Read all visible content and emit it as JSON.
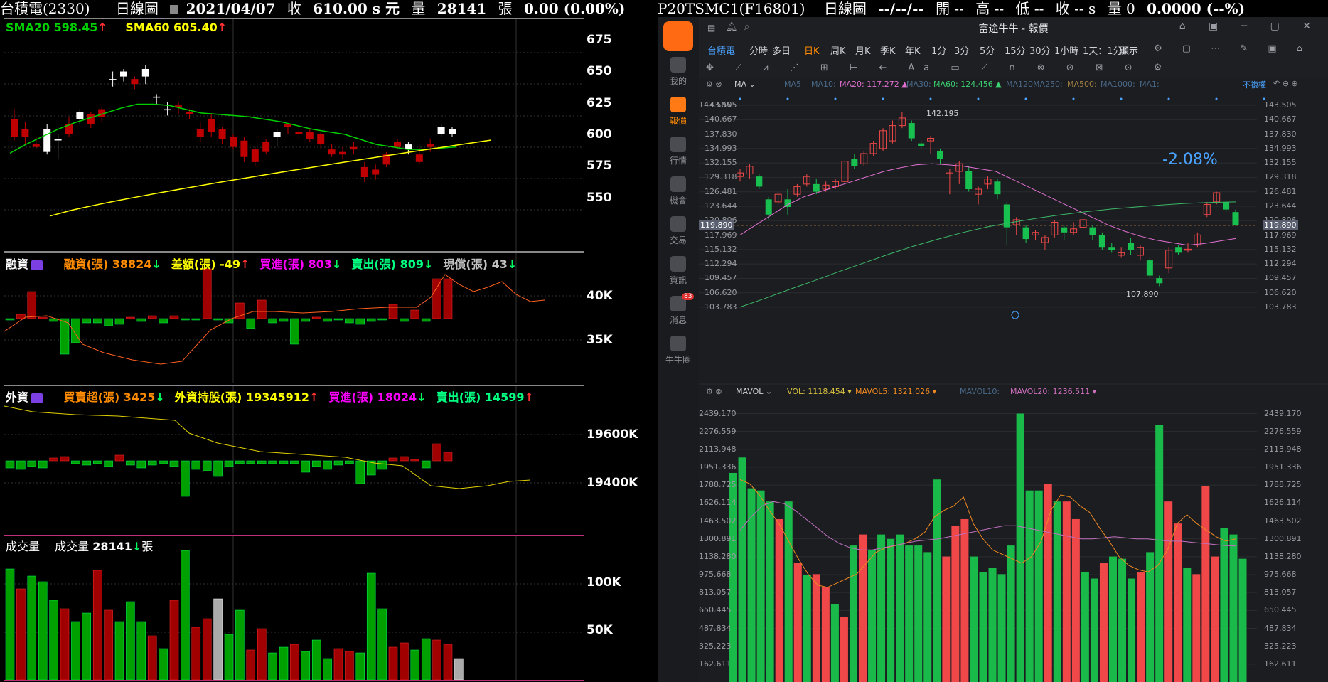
{
  "left_header": {
    "stock": "台積電(2330)",
    "chart_type": "日線圖",
    "date": "2021/04/07",
    "close_label": "收",
    "close_value": "610.00 s 元",
    "volume_label": "量",
    "volume_value": "28141",
    "volume_unit": "張",
    "change": "0.00 (0.00%)"
  },
  "price_panel": {
    "sma20_label": "SMA20 598.45",
    "sma60_label": "SMA60 605.40",
    "yticks": [
      "675",
      "650",
      "625",
      "600",
      "575",
      "550"
    ],
    "colors": {
      "sma20": "#00d000",
      "sma60": "#ffff00",
      "up": "#ffffff",
      "down": "#c00000"
    }
  },
  "margin_panel": {
    "title": "融資",
    "items": [
      {
        "label": "融資(張)",
        "value": "38824",
        "dir": "down",
        "color": "#ff8c00"
      },
      {
        "label": "差額(張)",
        "value": "-49",
        "dir": "up",
        "color": "#ffff00"
      },
      {
        "label": "買進(張)",
        "value": "803",
        "dir": "down",
        "color": "#ff00ff"
      },
      {
        "label": "賣出(張)",
        "value": "809",
        "dir": "down",
        "color": "#00ff80"
      },
      {
        "label": "現償(張)",
        "value": "43",
        "dir": "down",
        "color": "#c0c0c0"
      }
    ],
    "yticks": [
      "40K",
      "35K"
    ]
  },
  "foreign_panel": {
    "title": "外資",
    "items": [
      {
        "label": "買賣超(張)",
        "value": "3425",
        "dir": "down",
        "color": "#ff8c00"
      },
      {
        "label": "外資持股(張)",
        "value": "19345912",
        "dir": "up",
        "color": "#ffff00"
      },
      {
        "label": "買進(張)",
        "value": "18024",
        "dir": "down",
        "color": "#ff00ff"
      },
      {
        "label": "賣出(張)",
        "value": "14599",
        "dir": "up",
        "color": "#00ff80"
      }
    ],
    "yticks": [
      "19600K",
      "19400K"
    ]
  },
  "volume_panel": {
    "title": "成交量",
    "label": "成交量",
    "value": "28141",
    "unit": "張",
    "yticks": [
      "100K",
      "50K"
    ]
  },
  "right_header": {
    "code": "P20TSMC1(F16801)",
    "chart_type": "日線圖",
    "date": "--/--/--",
    "open": "開 --",
    "high": "高 --",
    "low": "低 --",
    "close": "收 -- s",
    "volume": "量 0",
    "change": "0.0000 (--%)"
  },
  "app": {
    "title": "富途牛牛 - 報價",
    "stock_tab": "台積電",
    "tabs": [
      "分時",
      "多日",
      "日K",
      "周K",
      "月K",
      "季K",
      "年K",
      "1分",
      "3分",
      "5分",
      "15分",
      "30分",
      "1小時",
      "1天：1分K"
    ],
    "active_tab": "日K",
    "display_label": "顯示",
    "sidebar": [
      {
        "label": "我的",
        "icon": "user-icon"
      },
      {
        "label": "報價",
        "icon": "quote-icon"
      },
      {
        "label": "行情",
        "icon": "market-icon"
      },
      {
        "label": "機會",
        "icon": "opportunity-icon"
      },
      {
        "label": "交易",
        "icon": "trade-icon"
      },
      {
        "label": "資訊",
        "icon": "news-icon"
      },
      {
        "label": "消息",
        "icon": "message-icon",
        "badge": "83"
      },
      {
        "label": "牛牛圈",
        "icon": "community-icon"
      }
    ]
  },
  "ma_bar": {
    "label": "MA",
    "items": [
      "MA5",
      "MA10:",
      "MA20: 117.272",
      "MA30:",
      "MA60: 124.456",
      "MA120:",
      "MA250:",
      "MA500:",
      "MA1000:",
      "MA1:"
    ],
    "colors": [
      "#4a6a8a",
      "#4a6a8a",
      "#e070d0",
      "#4a6a8a",
      "#3cd070",
      "#4a6a8a",
      "#4a6a8a",
      "#a08040",
      "#4a6a8a",
      "#4a6a8a"
    ],
    "adjust_label": "不複權"
  },
  "kline": {
    "yticks": [
      "143.505",
      "140.667",
      "137.830",
      "134.993",
      "132.155",
      "129.318",
      "126.481",
      "123.644",
      "120.806",
      "117.969",
      "115.132",
      "112.294",
      "109.457",
      "106.620",
      "103.783"
    ],
    "current_price": "119.890",
    "high_label": "142.195",
    "low_label": "107.890",
    "change_pct": "-2.08%"
  },
  "mavol_bar": {
    "label": "MAVOL",
    "vol": "VOL: 1118.454",
    "mavol5": "MAVOL5: 1321.026",
    "mavol10": "MAVOL10:",
    "mavol20": "MAVOL20: 1236.511"
  },
  "vol_axis": {
    "yticks": [
      "2439.170",
      "2276.559",
      "2113.948",
      "1951.336",
      "1788.725",
      "1626.114",
      "1463.502",
      "1300.891",
      "1138.280",
      "975.668",
      "813.057",
      "650.445",
      "487.834",
      "325.223",
      "162.611"
    ]
  }
}
